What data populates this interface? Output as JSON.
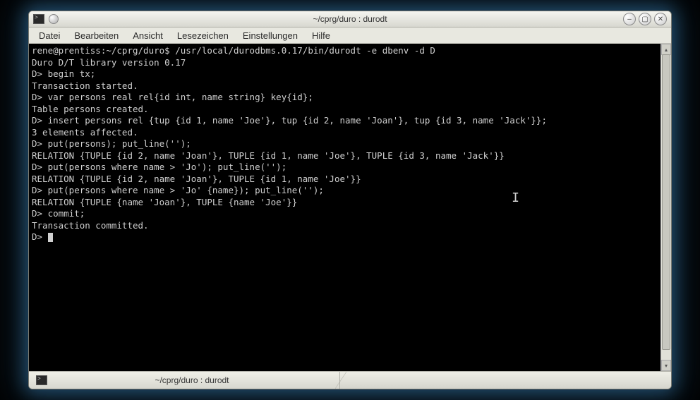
{
  "window": {
    "title": "~/cprg/duro : durodt"
  },
  "menu": {
    "file": "Datei",
    "edit": "Bearbeiten",
    "view": "Ansicht",
    "bookmarks": "Lesezeichen",
    "settings": "Einstellungen",
    "help": "Hilfe"
  },
  "terminal": {
    "lines": [
      "rene@prentiss:~/cprg/duro$ /usr/local/durodbms.0.17/bin/durodt -e dbenv -d D",
      "Duro D/T library version 0.17",
      "D> begin tx;",
      "Transaction started.",
      "D> var persons real rel{id int, name string} key{id};",
      "Table persons created.",
      "D> insert persons rel {tup {id 1, name 'Joe'}, tup {id 2, name 'Joan'}, tup {id 3, name 'Jack'}};",
      "3 elements affected.",
      "D> put(persons); put_line('');",
      "RELATION {TUPLE {id 2, name 'Joan'}, TUPLE {id 1, name 'Joe'}, TUPLE {id 3, name 'Jack'}}",
      "D> put(persons where name > 'Jo'); put_line('');",
      "RELATION {TUPLE {id 2, name 'Joan'}, TUPLE {id 1, name 'Joe'}}",
      "D> put(persons where name > 'Jo' {name}); put_line('');",
      "RELATION {TUPLE {name 'Joan'}, TUPLE {name 'Joe'}}",
      "D> commit;",
      "Transaction committed.",
      "D> "
    ]
  },
  "tab": {
    "label": "~/cprg/duro : durodt"
  },
  "glyph": {
    "min": "–",
    "max": "▢",
    "close": "✕",
    "up": "▴",
    "down": "▾"
  }
}
